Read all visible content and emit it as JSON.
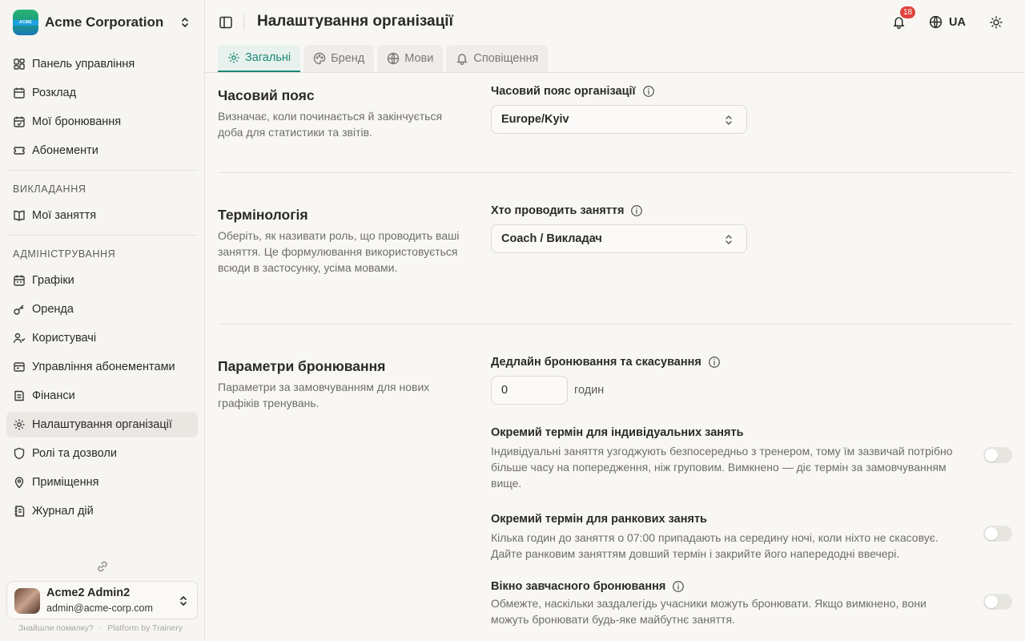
{
  "org": {
    "name": "Acme Corporation",
    "logo_text": "ACME"
  },
  "sidebar": {
    "main_items": [
      {
        "label": "Панель управління",
        "icon": "dashboard-icon"
      },
      {
        "label": "Розклад",
        "icon": "calendar-icon"
      },
      {
        "label": "Мої бронювання",
        "icon": "calendar-check-icon"
      },
      {
        "label": "Абонементи",
        "icon": "ticket-icon"
      }
    ],
    "teaching_label": "ВИКЛАДАННЯ",
    "teaching_items": [
      {
        "label": "Мої заняття",
        "icon": "book-icon"
      }
    ],
    "admin_label": "АДМІНІСТРУВАННЯ",
    "admin_items": [
      {
        "label": "Графіки",
        "icon": "schedule-icon"
      },
      {
        "label": "Оренда",
        "icon": "key-icon"
      },
      {
        "label": "Користувачі",
        "icon": "users-icon"
      },
      {
        "label": "Управління абонементами",
        "icon": "manage-passes-icon"
      },
      {
        "label": "Фінанси",
        "icon": "wallet-icon"
      },
      {
        "label": "Налаштування організації",
        "icon": "settings-icon",
        "active": true
      },
      {
        "label": "Ролі та дозволи",
        "icon": "shield-icon"
      },
      {
        "label": "Приміщення",
        "icon": "location-pin-icon"
      },
      {
        "label": "Журнал дій",
        "icon": "log-icon"
      }
    ]
  },
  "user": {
    "name": "Acme2 Admin2",
    "email": "admin@acme-corp.com"
  },
  "footer": {
    "report": "Знайшли помилку?",
    "platform": "Platform by Trainery"
  },
  "header": {
    "title": "Налаштування організації",
    "notifications_count": "18",
    "language": "UA"
  },
  "tabs": [
    {
      "label": "Загальні",
      "icon": "gear-icon",
      "active": true
    },
    {
      "label": "Бренд",
      "icon": "palette-icon"
    },
    {
      "label": "Мови",
      "icon": "globe-icon"
    },
    {
      "label": "Сповіщення",
      "icon": "bell-icon"
    }
  ],
  "sections": {
    "timezone": {
      "title": "Часовий пояс",
      "description": "Визначає, коли починається й закінчується доба для статистики та звітів.",
      "field_label": "Часовий пояс організації",
      "value": "Europe/Kyiv"
    },
    "terminology": {
      "title": "Термінологія",
      "description": "Оберіть, як називати роль, що проводить ваші заняття. Це формулювання використовується всюди в застосунку, усіма мовами.",
      "field_label": "Хто проводить заняття",
      "value": "Coach / Викладач"
    },
    "booking": {
      "title": "Параметри бронювання",
      "description": "Параметри за замовчуванням для нових графіків тренувань.",
      "deadline_label": "Дедлайн бронювання та скасування",
      "deadline_value": "0",
      "deadline_unit": "годин",
      "options": [
        {
          "title": "Окремий термін для індивідуальних занять",
          "description": "Індивідуальні заняття узгоджують безпосередньо з тренером, тому їм зазвичай потрібно більше часу на попередження, ніж груповим. Вимкнено — діє термін за замовчуванням вище.",
          "enabled": false
        },
        {
          "title": "Окремий термін для ранкових занять",
          "description": "Кілька годин до заняття о 07:00 припадають на середину ночі, коли ніхто не скасовує. Дайте ранковим заняттям довший термін і закрийте його напередодні ввечері.",
          "enabled": false
        },
        {
          "title": "Вікно завчасного бронювання",
          "description": "Обмежте, наскільки заздалегідь учасники можуть бронювати. Якщо вимкнено, вони можуть бронювати будь-яке майбутнє заняття.",
          "enabled": false
        }
      ]
    }
  },
  "colors": {
    "accent": "#1b8a74",
    "badge": "#e0433f",
    "background": "#f8f7f4"
  }
}
